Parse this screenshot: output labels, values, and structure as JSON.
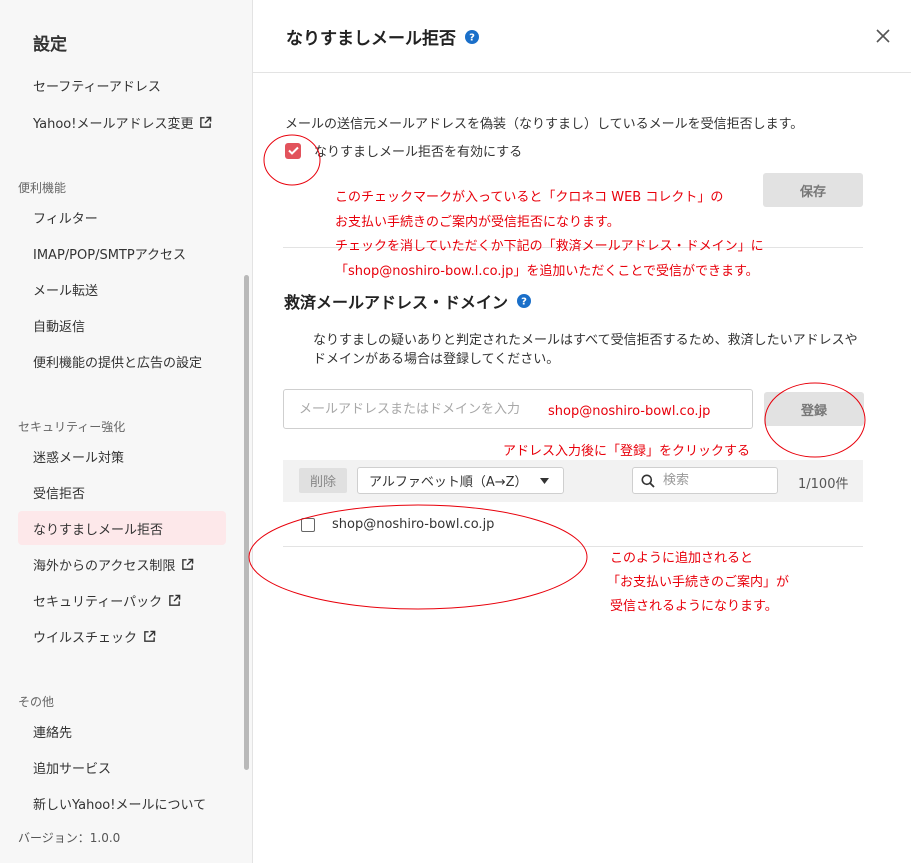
{
  "sidebar": {
    "title": "設定",
    "items_top": [
      {
        "label": "セーフティーアドレス",
        "external": false
      },
      {
        "label": "Yahoo!メールアドレス変更",
        "external": true
      }
    ],
    "section_convenience": "便利機能",
    "items_convenience": [
      {
        "label": "フィルター"
      },
      {
        "label": "IMAP/POP/SMTPアクセス"
      },
      {
        "label": "メール転送"
      },
      {
        "label": "自動返信"
      },
      {
        "label": "便利機能の提供と広告の設定"
      }
    ],
    "section_security": "セキュリティー強化",
    "items_security": [
      {
        "label": "迷惑メール対策"
      },
      {
        "label": "受信拒否"
      },
      {
        "label": "なりすましメール拒否",
        "active": true
      },
      {
        "label": "海外からのアクセス制限",
        "external": true
      },
      {
        "label": "セキュリティーパック",
        "external": true
      },
      {
        "label": "ウイルスチェック",
        "external": true
      }
    ],
    "section_other": "その他",
    "items_other": [
      {
        "label": "連絡先"
      },
      {
        "label": "追加サービス"
      },
      {
        "label": "新しいYahoo!メールについて"
      }
    ],
    "version": "バージョン：1.0.0"
  },
  "main": {
    "title": "なりすましメール拒否",
    "description": "メールの送信元メールアドレスを偽装（なりすまし）しているメールを受信拒否します。",
    "enable_checkbox_label": "なりすましメール拒否を有効にする",
    "enable_checked": true,
    "save_label": "保存",
    "rescue": {
      "title": "救済メールアドレス・ドメイン",
      "description": "なりすましの疑いありと判定されたメールはすべて受信拒否するため、救済したいアドレスやドメインがある場合は登録してください。",
      "input_placeholder": "メールアドレスまたはドメインを入力",
      "register_label": "登録",
      "delete_label": "削除",
      "sort_value": "アルファベット順（A→Z）",
      "search_placeholder": "検索",
      "count": "1/100件",
      "entries": [
        "shop@noshiro-bowl.co.jp"
      ]
    }
  },
  "annotations": {
    "note1_lines": [
      "このチェックマークが入っていると「クロネコ WEB コレクト」の",
      "お支払い手続きのご案内が受信拒否になります。",
      "チェックを消していただくか下記の「救済メールアドレス・ドメイン」に",
      "「shop@noshiro-bow.l.co.jp」を追加いただくことで受信ができます。"
    ],
    "input_example": "shop@noshiro-bowl.co.jp",
    "note2": "アドレス入力後に「登録」をクリックする",
    "note3_lines": [
      "このように追加されると",
      "「お支払い手続きのご案内」が",
      "受信されるようになります。"
    ],
    "color": "#e8000b"
  }
}
